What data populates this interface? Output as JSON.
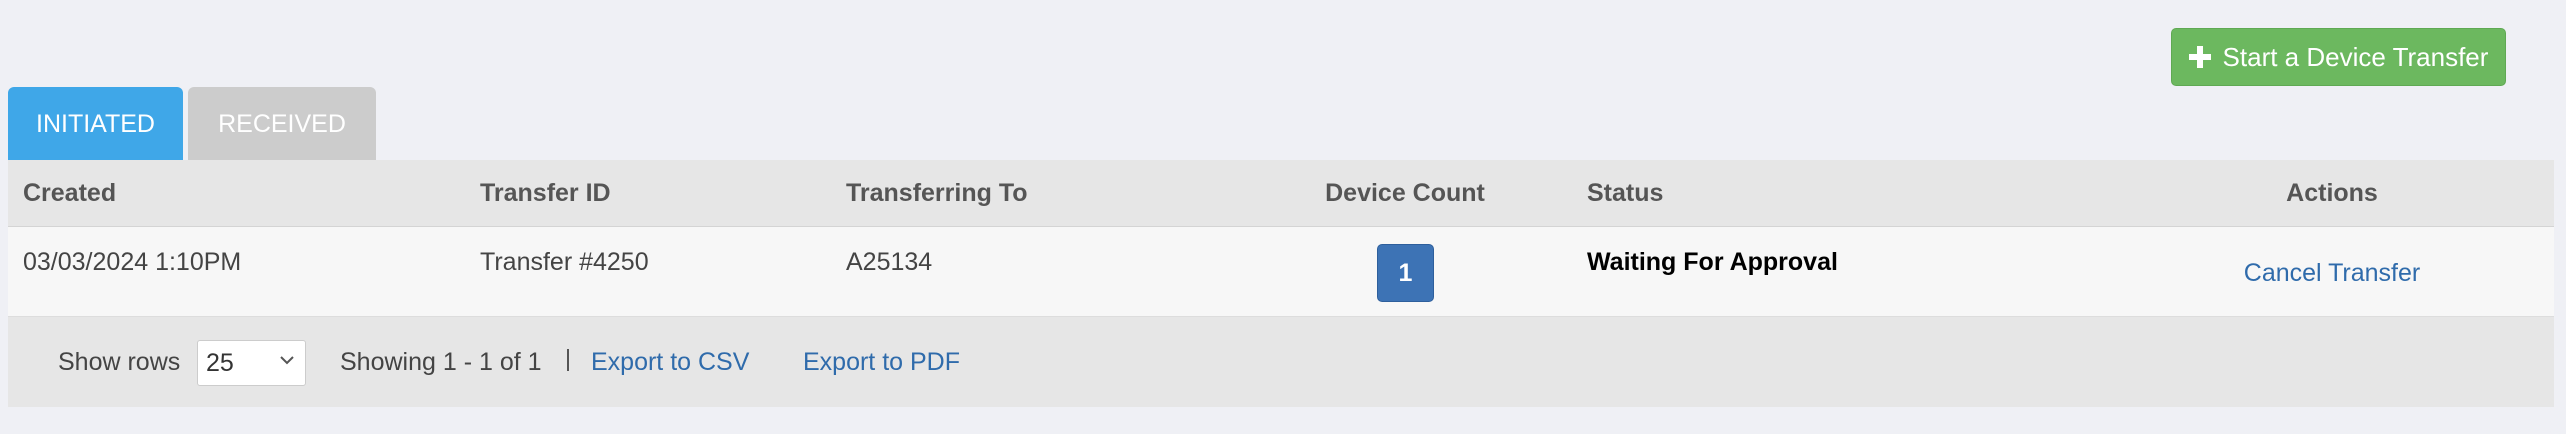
{
  "header": {
    "start_button_label": "Start a Device Transfer",
    "start_button_icon": "plus-icon",
    "accent_green": "#6cb85f"
  },
  "tabs": [
    {
      "label": "INITIATED",
      "active": true,
      "color": "#3fa7e8"
    },
    {
      "label": "RECEIVED",
      "active": false,
      "color": "#cccccc"
    }
  ],
  "table": {
    "columns": [
      "Created",
      "Transfer ID",
      "Transferring To",
      "Device Count",
      "Status",
      "Actions"
    ],
    "rows": [
      {
        "created": "03/03/2024 1:10PM",
        "transfer_id": "Transfer #4250",
        "transferring_to": "A25134",
        "device_count": "1",
        "status": "Waiting For Approval",
        "action": "Cancel Transfer"
      }
    ]
  },
  "footer": {
    "show_rows_label": "Show rows",
    "rows_per_page": "25",
    "showing_text": "Showing 1 - 1 of 1",
    "export_csv": "Export to CSV",
    "export_pdf": "Export to PDF"
  }
}
